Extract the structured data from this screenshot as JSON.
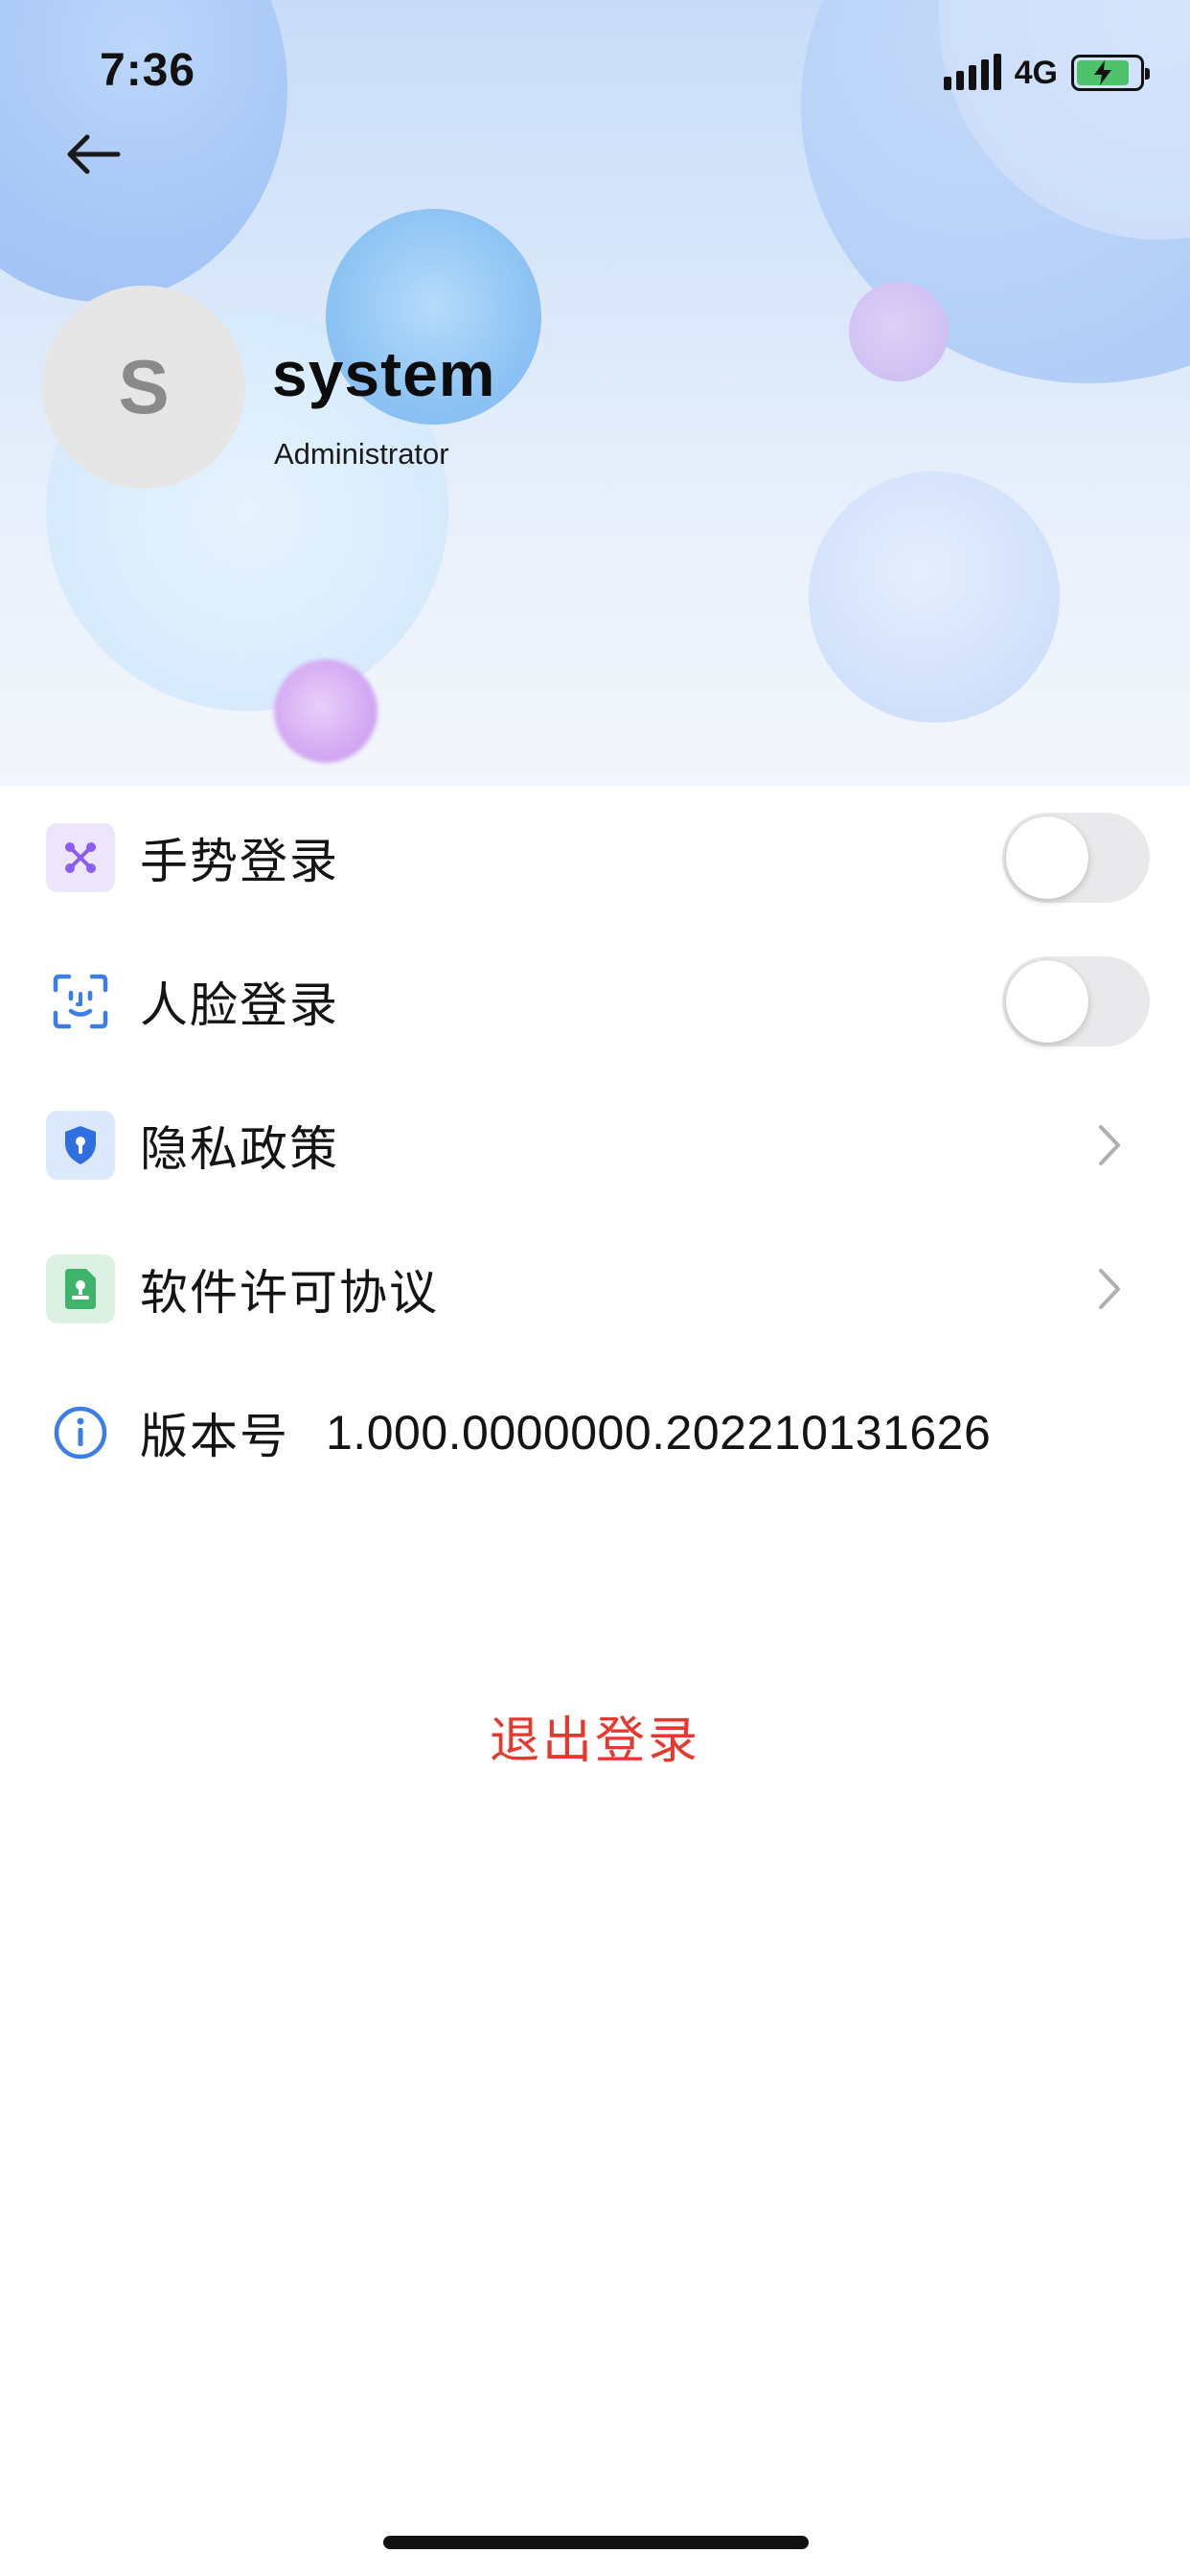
{
  "status_bar": {
    "time": "7:36",
    "network": "4G",
    "battery_level": 0.85,
    "battery_charging": true
  },
  "nav": {
    "back_icon": "arrow-left-icon"
  },
  "profile": {
    "avatar_initial": "S",
    "name": "system",
    "role": "Administrator"
  },
  "settings": {
    "gesture_login": {
      "label": "手势登录",
      "icon": "gesture-icon",
      "enabled": false
    },
    "face_login": {
      "label": "人脸登录",
      "icon": "face-id-icon",
      "enabled": false
    },
    "privacy_policy": {
      "label": "隐私政策",
      "icon": "shield-icon"
    },
    "license": {
      "label": "软件许可协议",
      "icon": "document-icon"
    },
    "version": {
      "label": "版本号",
      "value": "1.000.0000000.202210131626",
      "icon": "info-icon"
    }
  },
  "logout_label": "退出登录",
  "colors": {
    "accent_red": "#e5392f",
    "gesture_icon": "#8b5cf6",
    "face_icon": "#3b7de9",
    "shield_icon": "#2f6fe0",
    "document_icon": "#3fb46a",
    "battery": "#4cc36a"
  }
}
